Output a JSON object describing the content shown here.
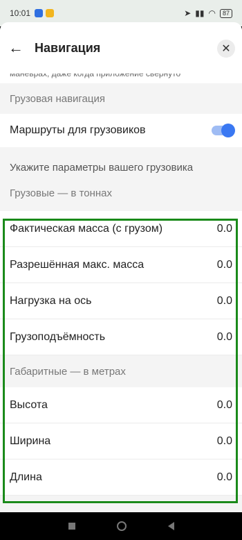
{
  "status": {
    "time": "10:01",
    "battery": "87"
  },
  "header": {
    "back_icon": "←",
    "title": "Навигация",
    "close_icon": "✕"
  },
  "cut_text": "манёврах, даже когда приложение свёрнуто",
  "truck_nav": {
    "section_title": "Грузовая навигация",
    "routes_label": "Маршруты для грузовиков",
    "routes_enabled": true
  },
  "params_hint": "Укажите параметры вашего грузовика",
  "weight_section": {
    "title": "Грузовые — в тоннах",
    "rows": [
      {
        "label": "Фактическая масса (с грузом)",
        "value": "0.0"
      },
      {
        "label": "Разрешённая макс. масса",
        "value": "0.0"
      },
      {
        "label": "Нагрузка на ось",
        "value": "0.0"
      },
      {
        "label": "Грузоподъёмность",
        "value": "0.0"
      }
    ]
  },
  "dims_section": {
    "title": "Габаритные — в метрах",
    "rows": [
      {
        "label": "Высота",
        "value": "0.0"
      },
      {
        "label": "Ширина",
        "value": "0.0"
      },
      {
        "label": "Длина",
        "value": "0.0"
      }
    ]
  },
  "colors": {
    "toggle_on": "#3a78f2",
    "highlight": "#1a8a1a"
  }
}
